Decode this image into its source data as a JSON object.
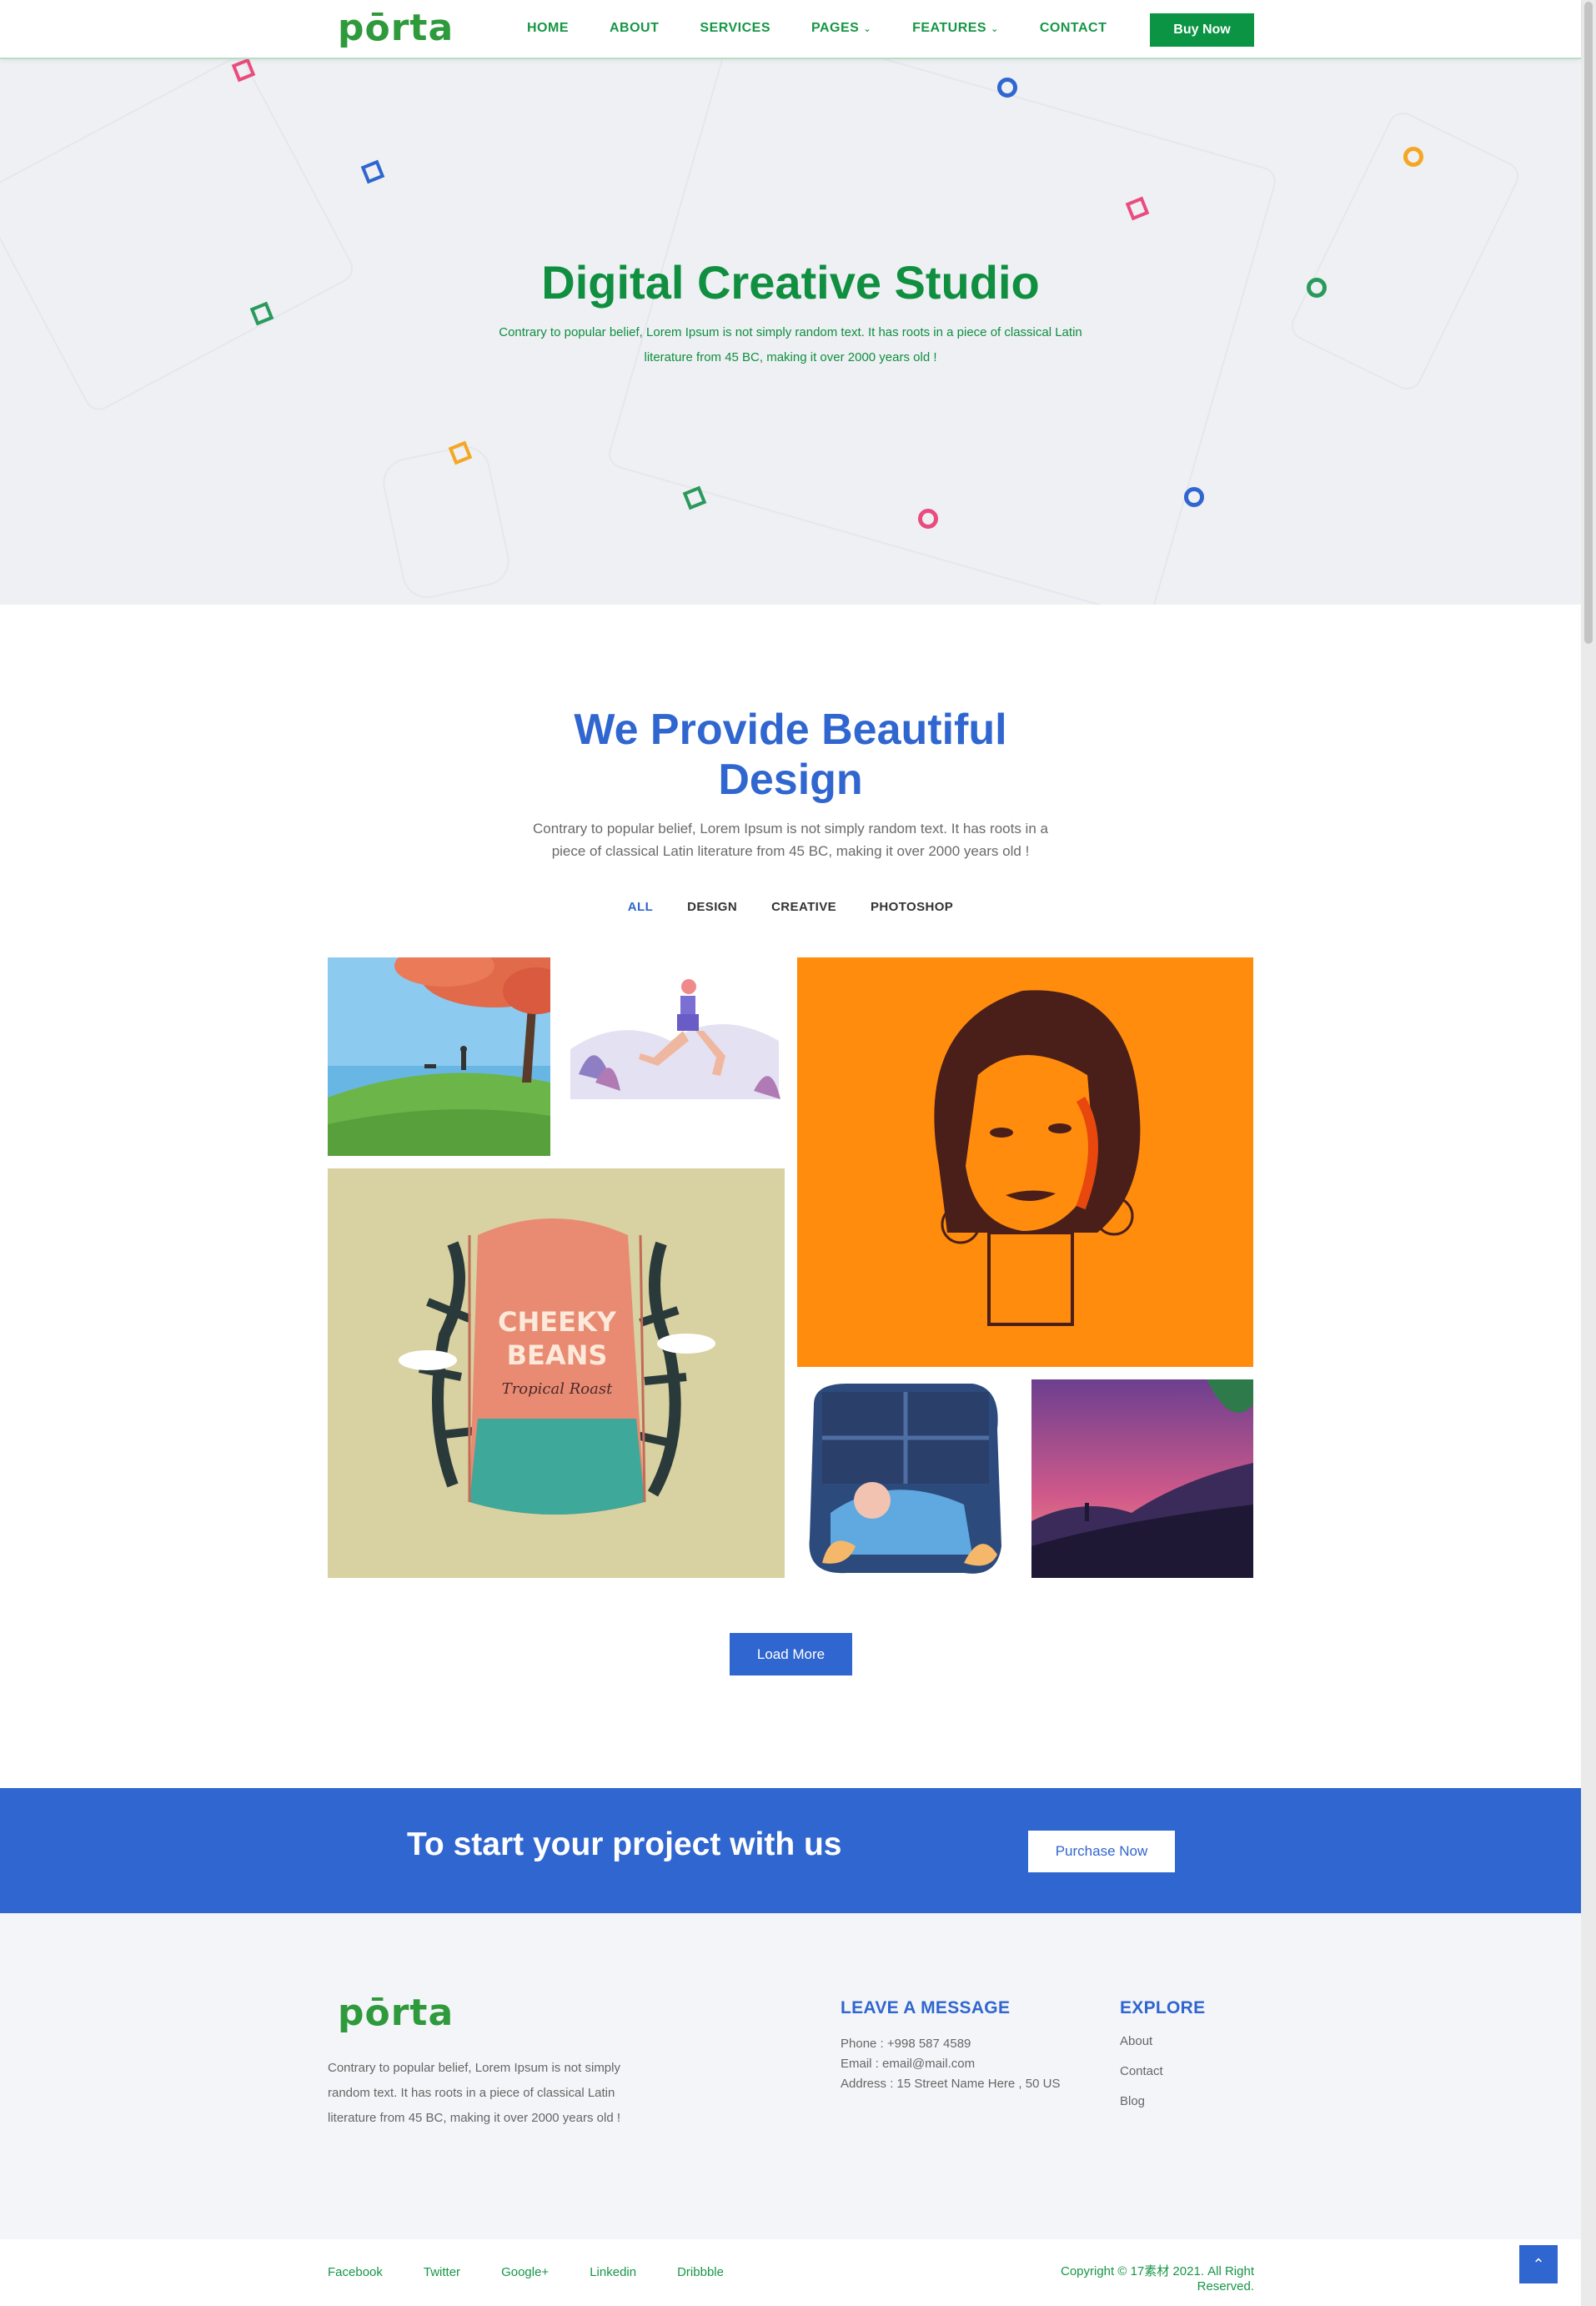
{
  "brand": {
    "logo_text": "pōrta",
    "primary_green": "#0a9443",
    "primary_blue": "#3066cf"
  },
  "nav": {
    "items": [
      {
        "label": "HOME"
      },
      {
        "label": "ABOUT"
      },
      {
        "label": "SERVICES"
      },
      {
        "label": "PAGES",
        "has_dropdown": true
      },
      {
        "label": "FEATURES",
        "has_dropdown": true
      },
      {
        "label": "CONTACT"
      }
    ],
    "cta_label": "Buy Now"
  },
  "hero": {
    "title": "Digital Creative Studio",
    "subtitle": "Contrary to popular belief, Lorem Ipsum is not simply random text. It has roots in a piece of classical Latin literature from 45 BC, making it over 2000 years old !"
  },
  "portfolio": {
    "title": "We Provide Beautiful Design",
    "subtitle": "Contrary to popular belief, Lorem Ipsum is not simply random text. It has roots in a piece of classical Latin literature from 45 BC, making it over 2000 years old !",
    "filters": [
      "ALL",
      "DESIGN",
      "CREATIVE",
      "PHOTOSHOP"
    ],
    "active_filter": "ALL",
    "load_more_label": "Load More",
    "packaging_text": {
      "line1": "CHEEKY",
      "line2": "BEANS",
      "line3": "Tropical Roast"
    }
  },
  "cta": {
    "text": "To start your project with us",
    "button_label": "Purchase Now"
  },
  "footer": {
    "about": "Contrary to popular belief, Lorem Ipsum is not simply random text. It has roots in a piece of classical Latin literature from 45 BC, making it over 2000 years old !",
    "contact_heading": "LEAVE A MESSAGE",
    "phone": "Phone : +998 587 4589",
    "email": "Email : email@mail.com",
    "address": "Address : 15 Street Name Here , 50 US",
    "explore_heading": "EXPLORE",
    "explore_links": [
      "About",
      "Contact",
      "Blog"
    ],
    "social": [
      "Facebook",
      "Twitter",
      "Google+",
      "Linkedin",
      "Dribbble"
    ],
    "copyright": "Copyright © 17素材 2021. All Right Reserved."
  },
  "icons": {
    "dropdown": "chevron-down-icon",
    "back_to_top": "chevron-up-icon"
  }
}
